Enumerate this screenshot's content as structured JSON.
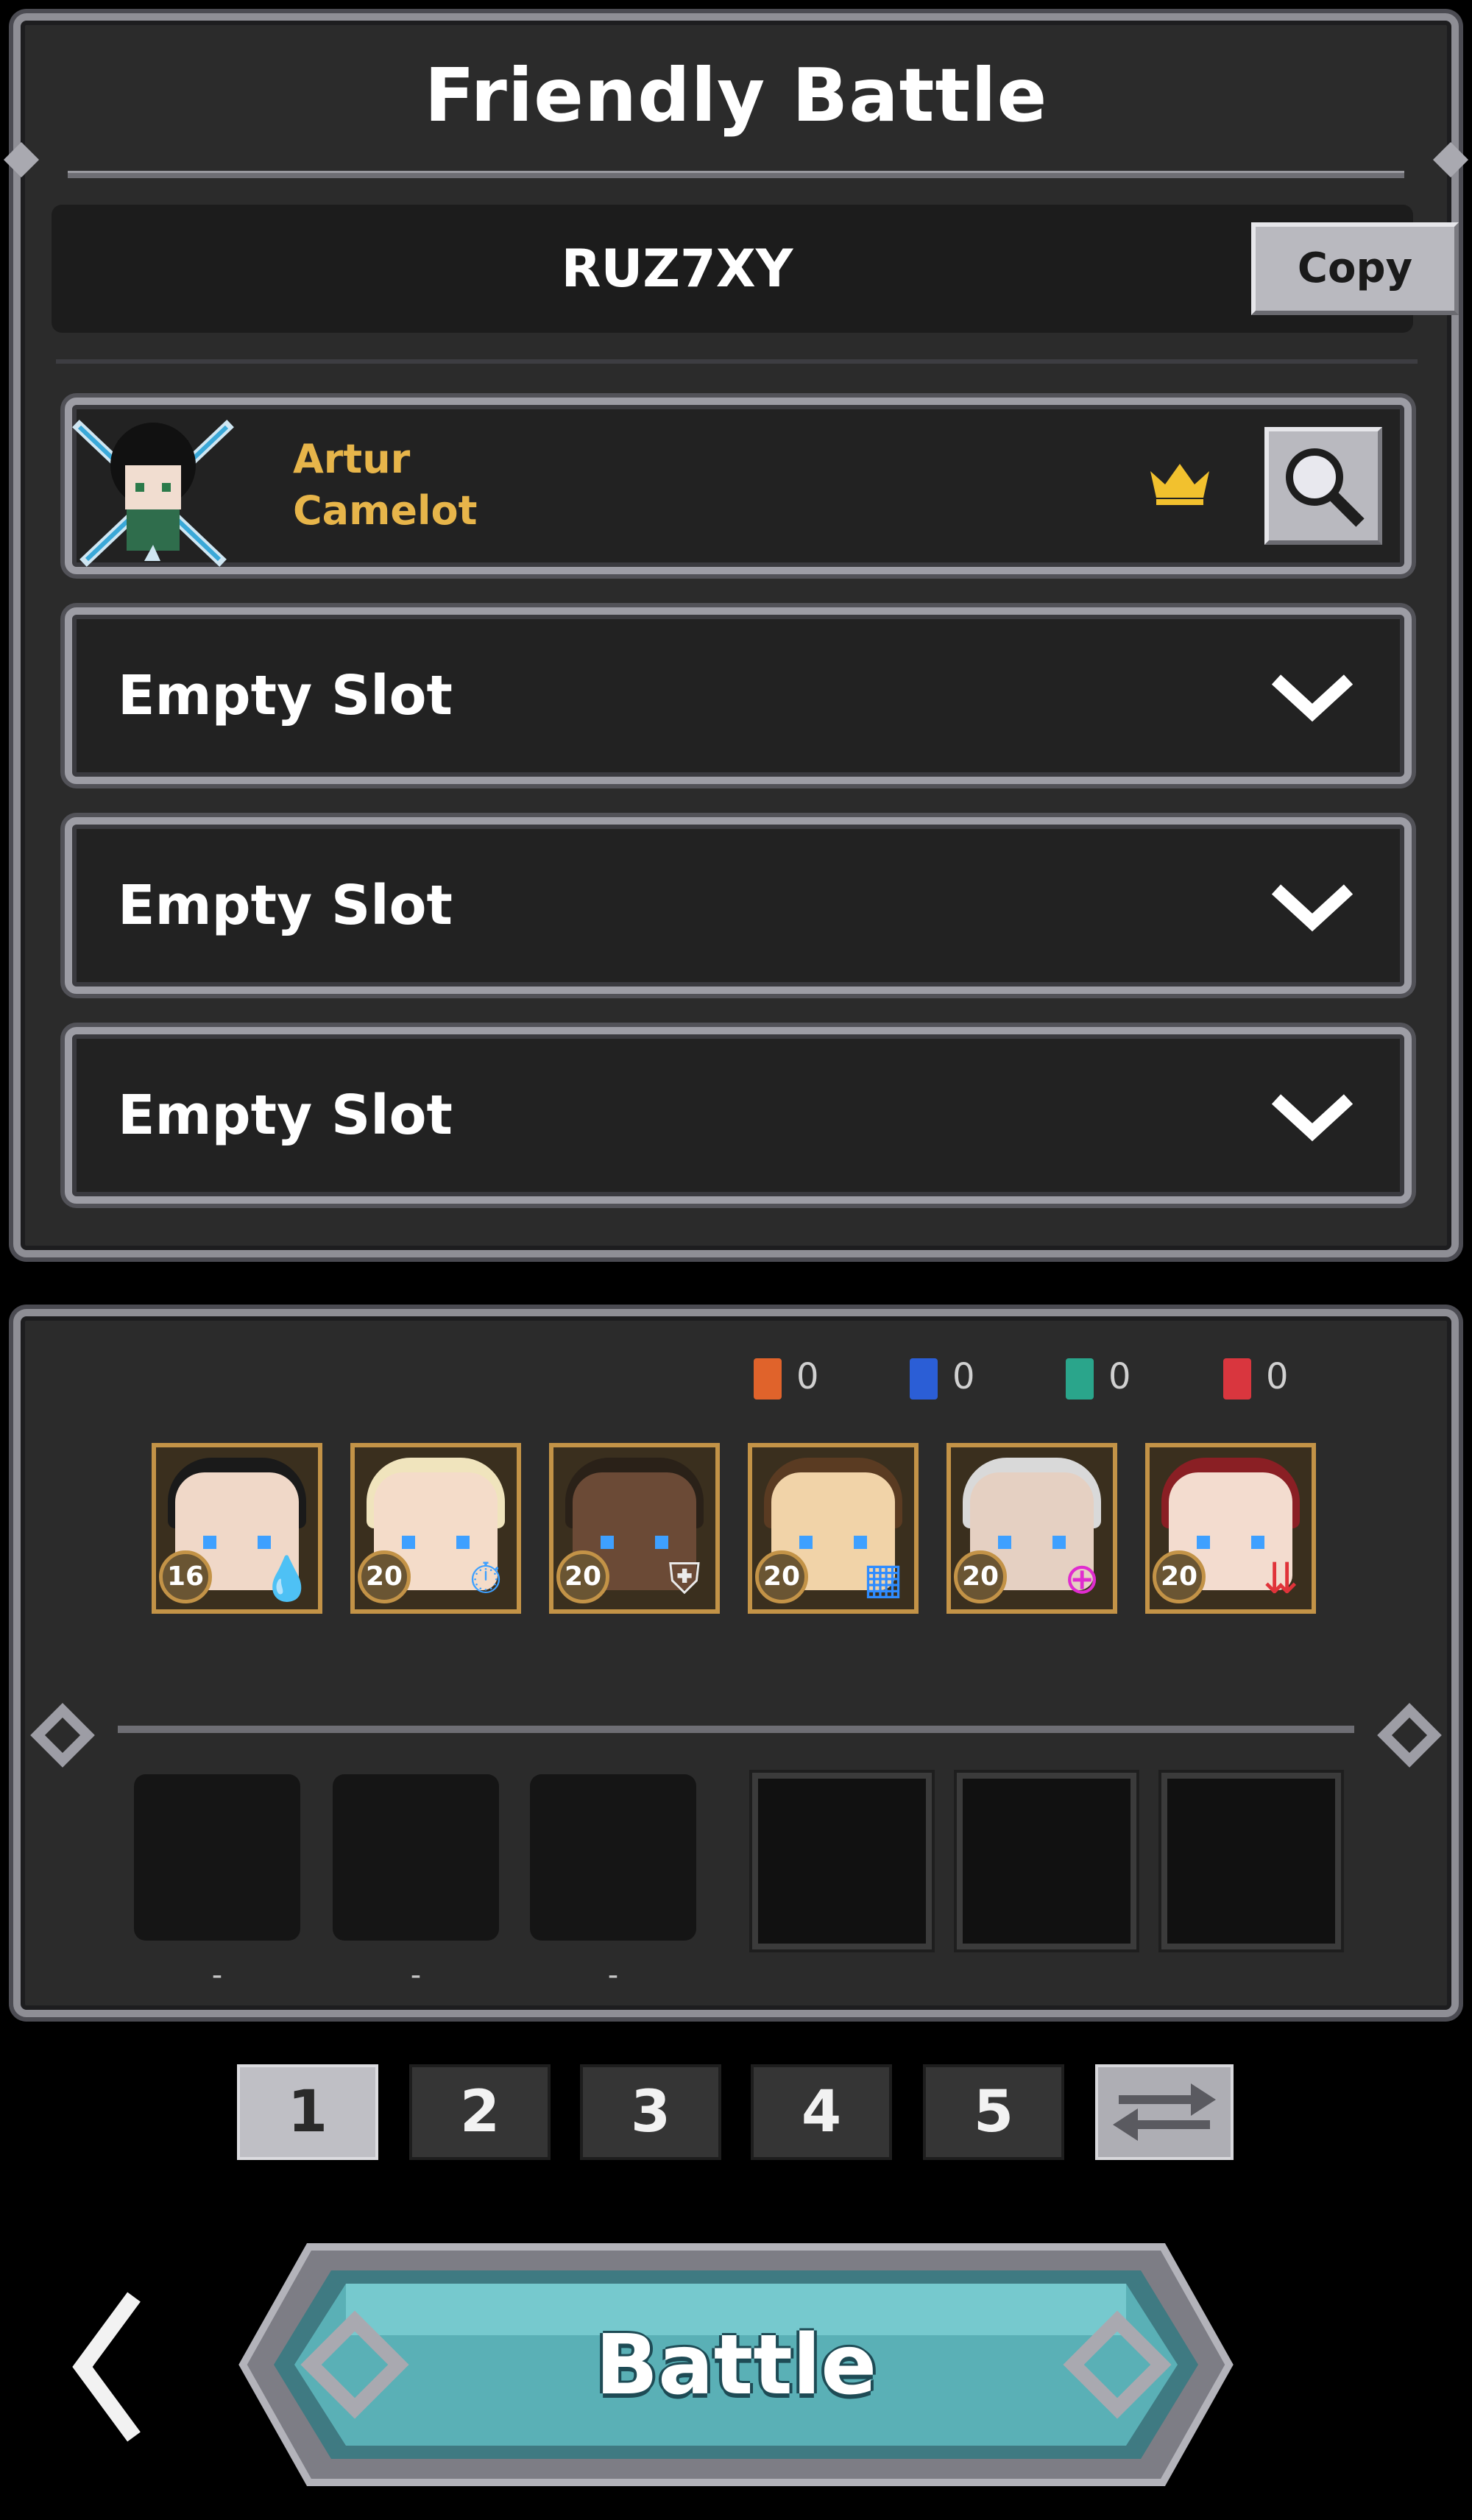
{
  "header": {
    "title": "Friendly Battle"
  },
  "room": {
    "code": "RUZ7XY",
    "copy_label": "Copy"
  },
  "player": {
    "name": "Artur",
    "guild": "Camelot",
    "crown_icon": "crown-icon",
    "search_icon": "magnifier-icon"
  },
  "slots": [
    {
      "label": "Empty Slot"
    },
    {
      "label": "Empty Slot"
    },
    {
      "label": "Empty Slot"
    }
  ],
  "card_counts": [
    {
      "icon": "orange-sword-card-icon",
      "color": "#e0632b",
      "value": "0"
    },
    {
      "icon": "blue-question-card-icon",
      "color": "#2b5ed6",
      "value": "0"
    },
    {
      "icon": "green-card-icon",
      "color": "#2aa58b",
      "value": "0"
    },
    {
      "icon": "red-heart-card-icon",
      "color": "#d9363e",
      "value": "0"
    }
  ],
  "heroes": [
    {
      "level": "16",
      "skill_icon": "purple-drops-icon",
      "hair": "#1a1a1a",
      "skin": "#f0d8c8",
      "skill_color": "#b04cff"
    },
    {
      "level": "20",
      "skill_icon": "blue-stopwatch-icon",
      "hair": "#f0e4bd",
      "skin": "#f4dcc9",
      "skill_color": "#3ea0ff"
    },
    {
      "level": "20",
      "skill_icon": "white-shield-icon",
      "hair": "#2a2118",
      "skin": "#6b4a36",
      "skill_color": "#eaeaea"
    },
    {
      "level": "20",
      "skill_icon": "blue-grid-icon",
      "hair": "#5a3b22",
      "skin": "#f1d3a8",
      "skill_color": "#2f8cff"
    },
    {
      "level": "20",
      "skill_icon": "magenta-target-icon",
      "hair": "#d9d9d9",
      "skin": "#e5d0c2",
      "skill_color": "#e02ccf"
    },
    {
      "level": "20",
      "skill_icon": "red-arrows-icon",
      "hair": "#8a1f24",
      "skin": "#f3dccf",
      "skill_color": "#e0333a"
    }
  ],
  "empty_slot_dashes": [
    "-",
    "-",
    "-"
  ],
  "tabs": [
    {
      "label": "1",
      "active": true
    },
    {
      "label": "2",
      "active": false
    },
    {
      "label": "3",
      "active": false
    },
    {
      "label": "4",
      "active": false
    },
    {
      "label": "5",
      "active": false
    }
  ],
  "swap_icon": "swap-arrows-icon",
  "back_icon": "chevron-left-icon",
  "battle": {
    "label": "Battle"
  },
  "colors": {
    "accent_teal": "#5ab0b6",
    "frame": "#8e8e95",
    "gold": "#e7b54a"
  }
}
